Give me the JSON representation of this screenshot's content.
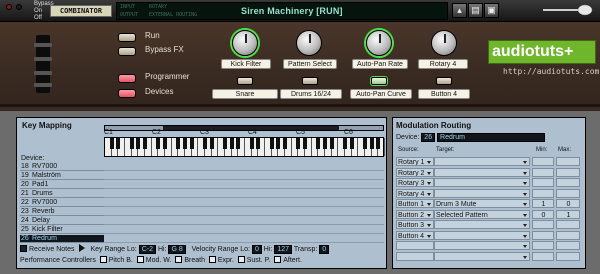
{
  "device_bar": {
    "bypass_label": "Bypass",
    "on_label": "On",
    "off_label": "Off",
    "device_name_label": "COMBINATOR",
    "patch_name": "Siren Machinery [RUN]",
    "mini_labels": [
      "INPUT",
      "OUTPUT",
      "ROTARY",
      "EXTERNAL ROUTING"
    ]
  },
  "panel": {
    "run_label": "Run",
    "bypass_fx_label": "Bypass FX",
    "programmer_label": "Programmer",
    "devices_label": "Devices",
    "knobs": [
      {
        "label": "Kick Filter",
        "selected": true
      },
      {
        "label": "Pattern Select",
        "selected": false
      },
      {
        "label": "Auto-Pan Rate",
        "selected": true
      },
      {
        "label": "Rotary 4",
        "selected": false
      }
    ],
    "buttons": [
      {
        "label": "Snare",
        "selected": false
      },
      {
        "label": "Drums 16/24",
        "selected": false
      },
      {
        "label": "Auto-Pan Curve",
        "selected": true
      },
      {
        "label": "Button 4",
        "selected": false
      }
    ],
    "logo_text": "audiotuts+",
    "logo_url": "http://audiotuts.com"
  },
  "key_mapping": {
    "title": "Key Mapping",
    "octaves": [
      "C1",
      "C2",
      "C3",
      "C4",
      "C5",
      "C6"
    ],
    "device_label": "Device:",
    "devices": [
      {
        "num": "18",
        "name": "RV7000"
      },
      {
        "num": "19",
        "name": "Malström"
      },
      {
        "num": "20",
        "name": "Pad1"
      },
      {
        "num": "21",
        "name": "Drums"
      },
      {
        "num": "22",
        "name": "RV7000"
      },
      {
        "num": "23",
        "name": "Reverb"
      },
      {
        "num": "24",
        "name": "Delay"
      },
      {
        "num": "25",
        "name": "Kick Filter"
      },
      {
        "num": "26",
        "name": "Redrum"
      }
    ],
    "selected_device_index": 8,
    "receive_notes_label": "Receive Notes",
    "key_range_label": "Key Range  Lo:",
    "key_range_lo": "C-2",
    "key_range_hi_label": "Hi:",
    "key_range_hi": "G 8",
    "velocity_range_label": "Velocity Range",
    "velocity_lo_label": "Lo:",
    "velocity_lo": "0",
    "velocity_hi_label": "Hi:",
    "velocity_hi": "127",
    "transp_label": "Transp:",
    "transp_value": "0",
    "perf_controllers_label": "Performance Controllers",
    "perf_items": [
      "Pitch B.",
      "Mod. W.",
      "Breath",
      "Expr.",
      "Sust. P.",
      "Aftert."
    ]
  },
  "modulation_routing": {
    "title": "Modulation Routing",
    "device_label": "Device:",
    "device_num": "26",
    "device_name": "Redrum",
    "col_source": "Source:",
    "col_target": "Target:",
    "col_min": "Min:",
    "col_max": "Max:",
    "rows": [
      {
        "source": "Rotary 1",
        "target": "",
        "min": "",
        "max": ""
      },
      {
        "source": "Rotary 2",
        "target": "",
        "min": "",
        "max": ""
      },
      {
        "source": "Rotary 3",
        "target": "",
        "min": "",
        "max": ""
      },
      {
        "source": "Rotary 4",
        "target": "",
        "min": "",
        "max": ""
      },
      {
        "source": "Button 1",
        "target": "Drum 3 Mute",
        "min": "1",
        "max": "0"
      },
      {
        "source": "Button 2",
        "target": "Selected Pattern",
        "min": "0",
        "max": "1"
      },
      {
        "source": "Button 3",
        "target": "",
        "min": "",
        "max": ""
      },
      {
        "source": "Button 4",
        "target": "",
        "min": "",
        "max": ""
      },
      {
        "source": "",
        "target": "",
        "min": "",
        "max": ""
      },
      {
        "source": "",
        "target": "",
        "min": "",
        "max": ""
      }
    ]
  }
}
